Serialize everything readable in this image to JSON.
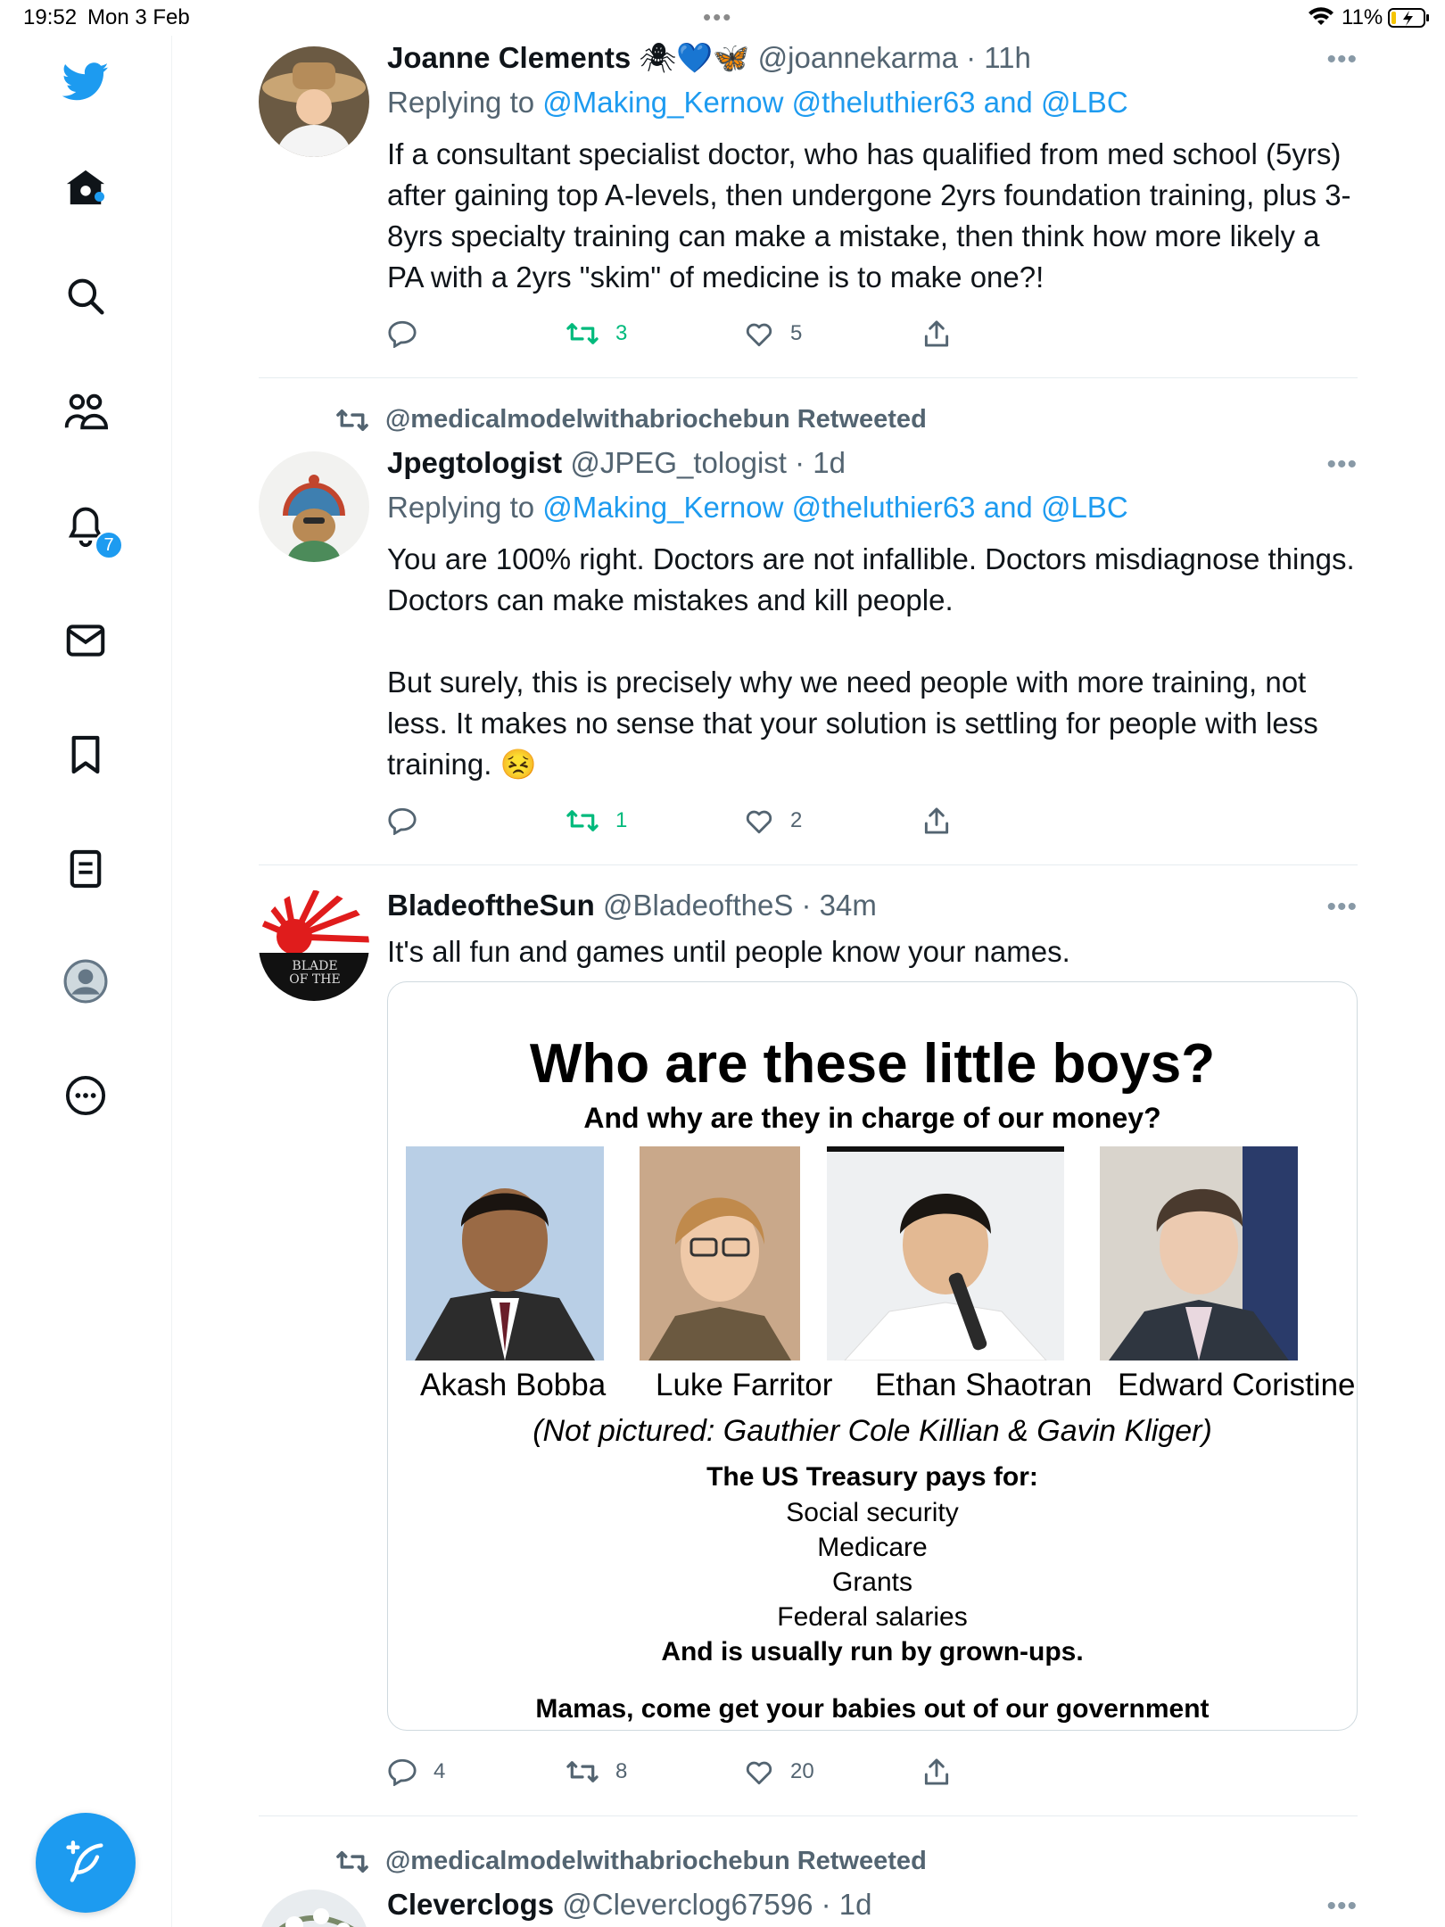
{
  "status_bar": {
    "time": "19:52",
    "date": "Mon 3 Feb",
    "battery": "11%"
  },
  "sidebar": {
    "notification_count": "7"
  },
  "tweets": [
    {
      "name": "Joanne Clements",
      "name_emoji": "🕷💙🦋",
      "handle": "@joannekarma",
      "time": "11h",
      "replying_prefix": "Replying to",
      "mentions": "@Making_Kernow @theluthier63",
      "and": "and",
      "last_mention": "@LBC",
      "text": "If a consultant specialist doctor, who has qualified from med school (5yrs) after gaining top A-levels, then undergone 2yrs foundation training, plus 3-8yrs specialty training can make a mistake, then think how more likely a PA with a 2yrs \"skim\" of medicine is to make one?!",
      "retweets": "3",
      "likes": "5"
    },
    {
      "retweeted_by": "@medicalmodelwithabriochebun Retweeted",
      "name": "Jpegtologist",
      "handle": "@JPEG_tologist",
      "time": "1d",
      "replying_prefix": "Replying to",
      "mentions": "@Making_Kernow @theluthier63",
      "and": "and",
      "last_mention": "@LBC",
      "text": "You are 100% right. Doctors are not infallible. Doctors misdiagnose things. Doctors can make mistakes and kill people.\n\nBut surely, this is precisely why we need people with more training, not less. It makes no sense that your solution is settling for people with less training. 😣",
      "retweets": "1",
      "likes": "2"
    },
    {
      "name": "BladeoftheSun",
      "handle": "@BladeoftheS",
      "time": "34m",
      "avatar_text": "BLADE OF THE",
      "text": "It's all fun and games until people know your names.",
      "replies": "4",
      "retweets": "8",
      "likes": "20",
      "card": {
        "title": "Who are these little boys?",
        "subtitle": "And why are they in charge of our money?",
        "people": [
          "Akash Bobba",
          "Luke Farritor",
          "Ethan Shaotran",
          "Edward Coristine"
        ],
        "note": "(Not pictured: Gauthier Cole Killian & Gavin Kliger)",
        "pays_heading": "The US Treasury pays for:",
        "pays_items": [
          "Social security",
          "Medicare",
          "Grants",
          "Federal salaries"
        ],
        "run_by": "And is usually run by grown-ups.",
        "closing": "Mamas, come get your babies out of our government"
      }
    },
    {
      "retweeted_by": "@medicalmodelwithabriochebun Retweeted",
      "name": "Cleverclogs",
      "handle": "@Cleverclog67596",
      "time": "1d"
    }
  ],
  "colors": {
    "accent": "#1d9bf0",
    "retweet_green": "#00ba7c",
    "muted": "#536471"
  }
}
